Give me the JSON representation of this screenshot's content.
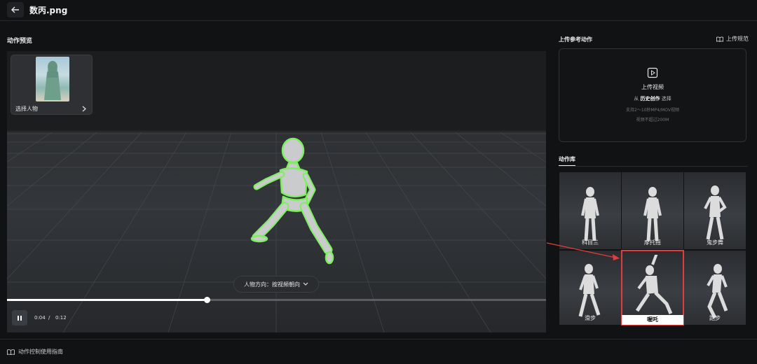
{
  "header": {
    "back_icon": "arrow-left-icon",
    "file_name": "数丙.png"
  },
  "preview": {
    "title": "动作预览",
    "character_card": {
      "label": "选择人物",
      "chevron_icon": "chevron-right-icon"
    },
    "orientation": {
      "label": "人物方向：按视频朝向",
      "chevron_icon": "chevron-down-icon"
    },
    "playback": {
      "current": "0:04",
      "separator": "/",
      "total": "0:12",
      "progress": 0.37,
      "state_icon": "pause-icon"
    },
    "outline_color": "#7cf05c"
  },
  "right": {
    "upload_title": "上传参考动作",
    "upload_spec": "上传规范",
    "upload_box": {
      "icon": "video-upload-icon",
      "title": "上传视频",
      "from_prefix": "从",
      "from_link": "历史创作",
      "from_suffix": "选择",
      "hint1": "支持2～10秒MP4/MOV视频",
      "hint2": "视频不超过200M"
    },
    "library_tab": "动作库",
    "motions": [
      {
        "label": "科目三",
        "pose": "stand"
      },
      {
        "label": "摩托摇",
        "pose": "stand"
      },
      {
        "label": "鬼步舞",
        "pose": "hip"
      },
      {
        "label": "滑步",
        "pose": "walk"
      },
      {
        "label": "喔吒",
        "pose": "dance",
        "selected": true
      },
      {
        "label": "跑步",
        "pose": "run"
      }
    ],
    "highlight_color": "#e23d3d"
  },
  "footer": {
    "guide_icon": "book-icon",
    "guide_label": "动作控制使用指南"
  }
}
